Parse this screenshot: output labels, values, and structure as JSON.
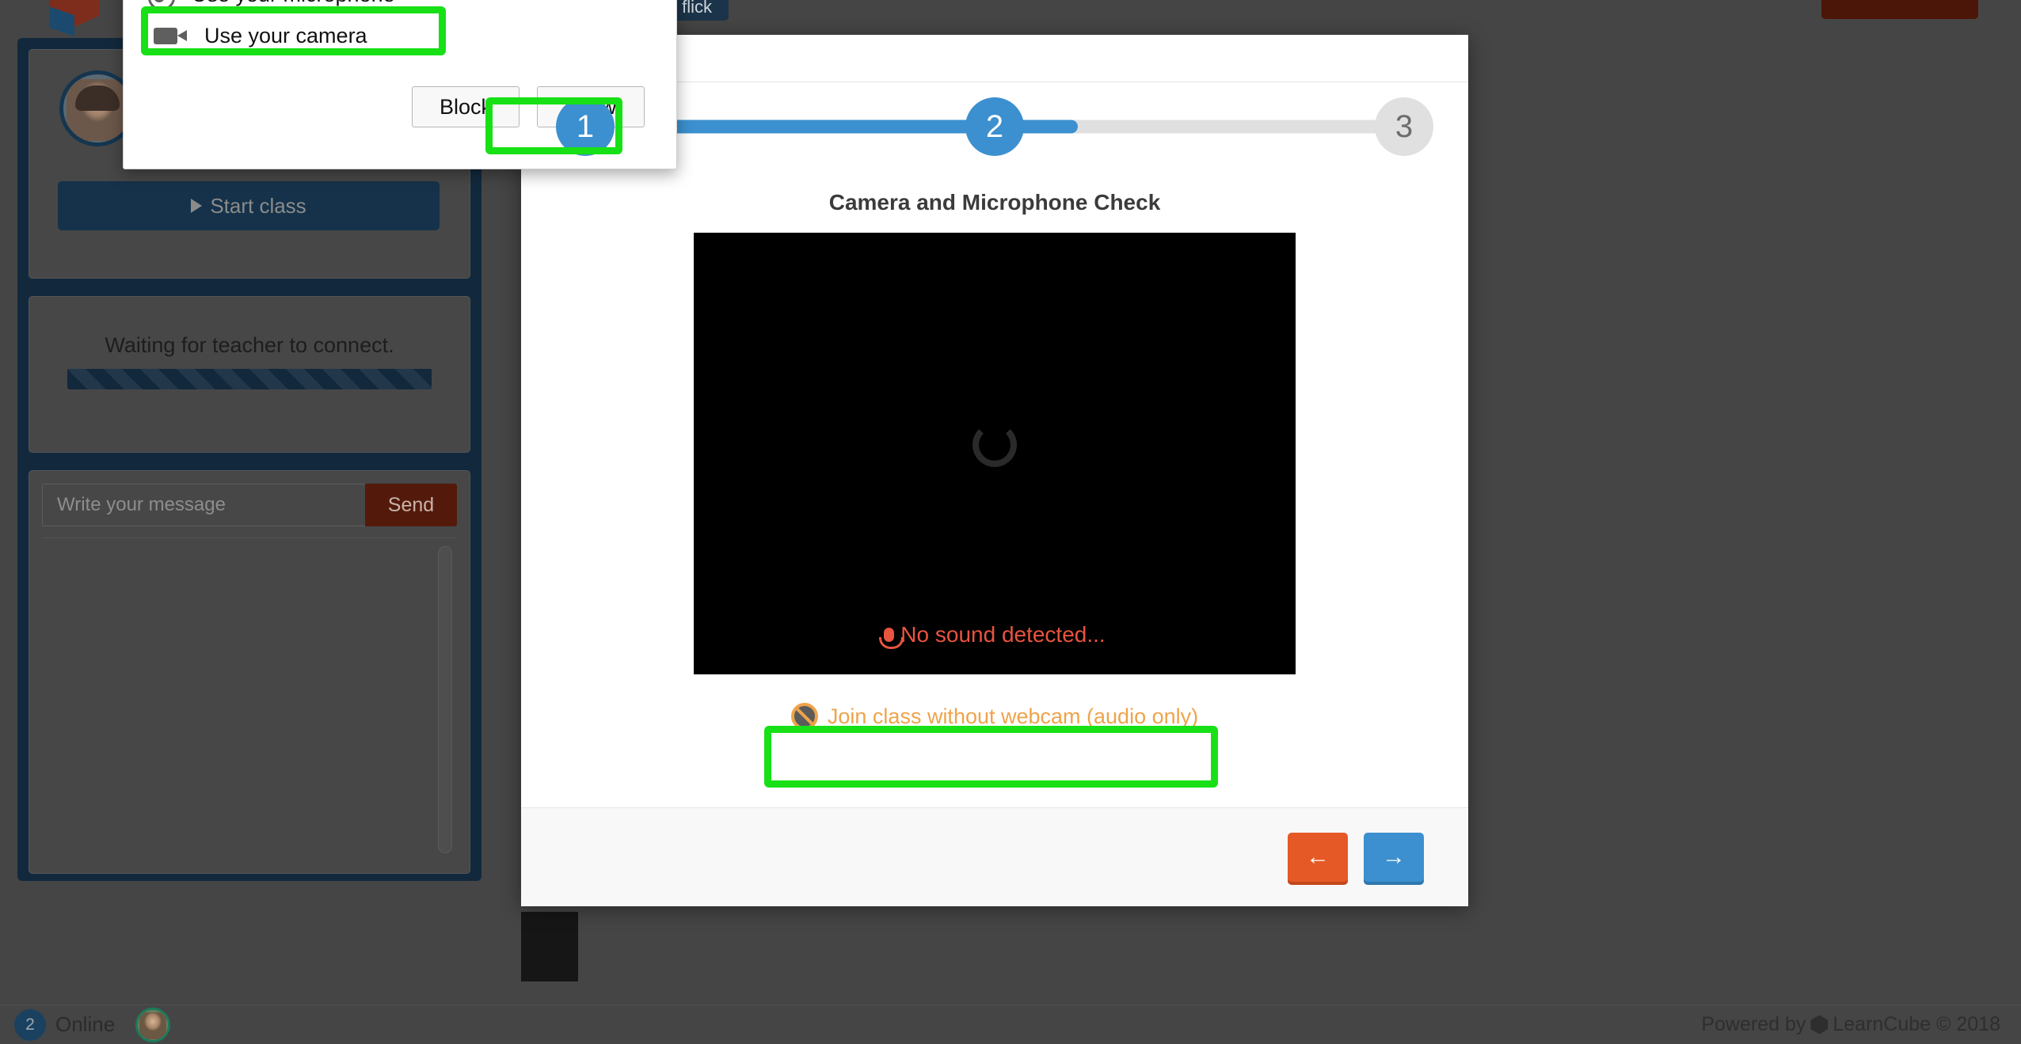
{
  "app": {
    "background_color": "#454545",
    "accent_blue": "#3c90cf",
    "accent_orange": "#e55926",
    "highlight_green": "#18e016"
  },
  "sidebar": {
    "teacher_panel": {
      "avatar_name": "teacher-avatar",
      "start_class_label": "Start class"
    },
    "waiting_panel": {
      "status_text": "Waiting for teacher to connect."
    },
    "chat_panel": {
      "input_placeholder": "Write your message",
      "input_value": "",
      "send_label": "Send"
    }
  },
  "top_partial": {
    "navy_button_label": "ve & flick",
    "red_button_label": ""
  },
  "modal": {
    "stepper": {
      "steps": [
        {
          "number": "1",
          "state": "done"
        },
        {
          "number": "2",
          "state": "done"
        },
        {
          "number": "3",
          "state": "todo"
        }
      ],
      "progress_percent": 58
    },
    "title": "Camera and Microphone Check",
    "video": {
      "state": "loading",
      "sound_status": "No sound detected..."
    },
    "audio_only_link": "Join class without webcam (audio only)",
    "footer": {
      "back_label": "←",
      "next_label": "→"
    }
  },
  "permission_popup": {
    "items": [
      {
        "icon": "microphone-icon",
        "label": "Use your microphone"
      },
      {
        "icon": "camera-icon",
        "label": "Use your camera"
      }
    ],
    "block_label": "Block",
    "allow_label": "Allow"
  },
  "statusbar": {
    "online_count": "2",
    "online_label": "Online",
    "credit_prefix": "Powered by",
    "credit_brand": "LearnCube © 2018"
  }
}
